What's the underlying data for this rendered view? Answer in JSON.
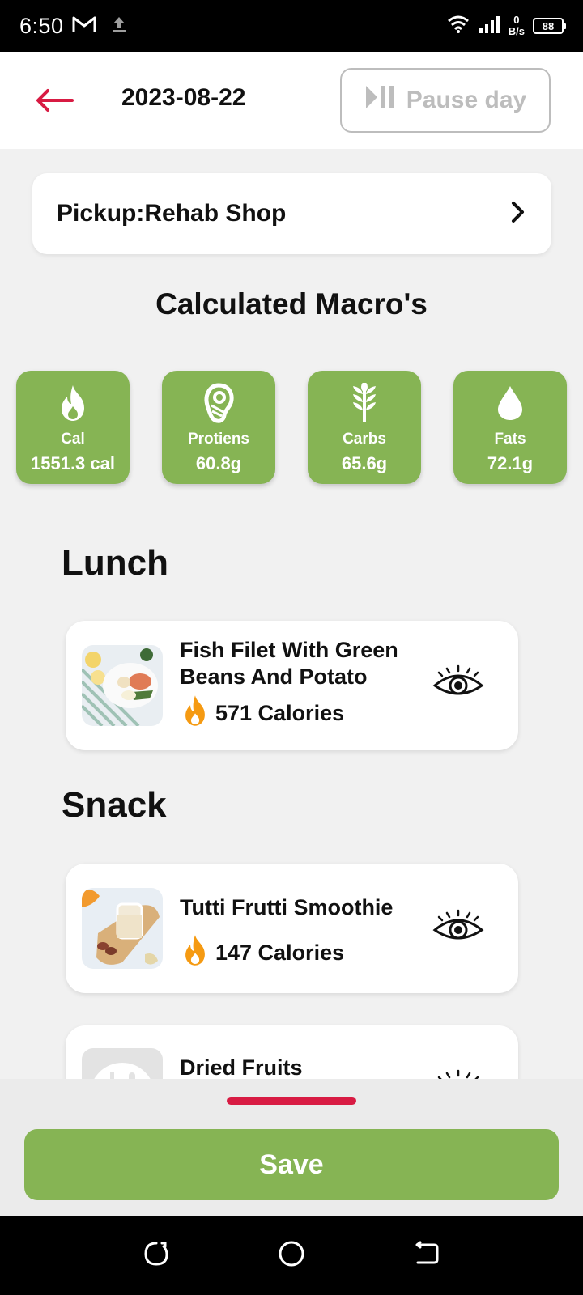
{
  "status_bar": {
    "time": "6:50",
    "net_speed_value": "0",
    "net_speed_unit": "B/s",
    "battery": "88",
    "icons": [
      "gmail-icon",
      "upload-icon",
      "wifi-icon",
      "signal-icon",
      "battery-icon"
    ]
  },
  "header": {
    "date": "2023-08-22",
    "pause_label": "Pause day",
    "back_icon": "arrow-left-icon",
    "accent_color": "#d81b43"
  },
  "pickup": {
    "label": "Pickup:Rehab Shop"
  },
  "macros": {
    "title": "Calculated Macro's",
    "items": [
      {
        "label": "Cal",
        "value": "1551.3 cal",
        "icon": "flame-icon"
      },
      {
        "label": "Protiens",
        "value": "60.8g",
        "icon": "meat-icon"
      },
      {
        "label": "Carbs",
        "value": "65.6g",
        "icon": "wheat-icon"
      },
      {
        "label": "Fats",
        "value": "72.1g",
        "icon": "drop-icon"
      }
    ],
    "color": "#86b454"
  },
  "meals": {
    "lunch_heading": "Lunch",
    "snack_heading": "Snack",
    "lunch": [
      {
        "name": "Fish Filet With Green Beans And Potato",
        "calories": "571 Calories"
      }
    ],
    "snack": [
      {
        "name": "Tutti Frutti Smoothie",
        "calories": "147 Calories"
      },
      {
        "name": "Dried Fruits",
        "calories": ""
      }
    ]
  },
  "footer": {
    "save_label": "Save"
  }
}
